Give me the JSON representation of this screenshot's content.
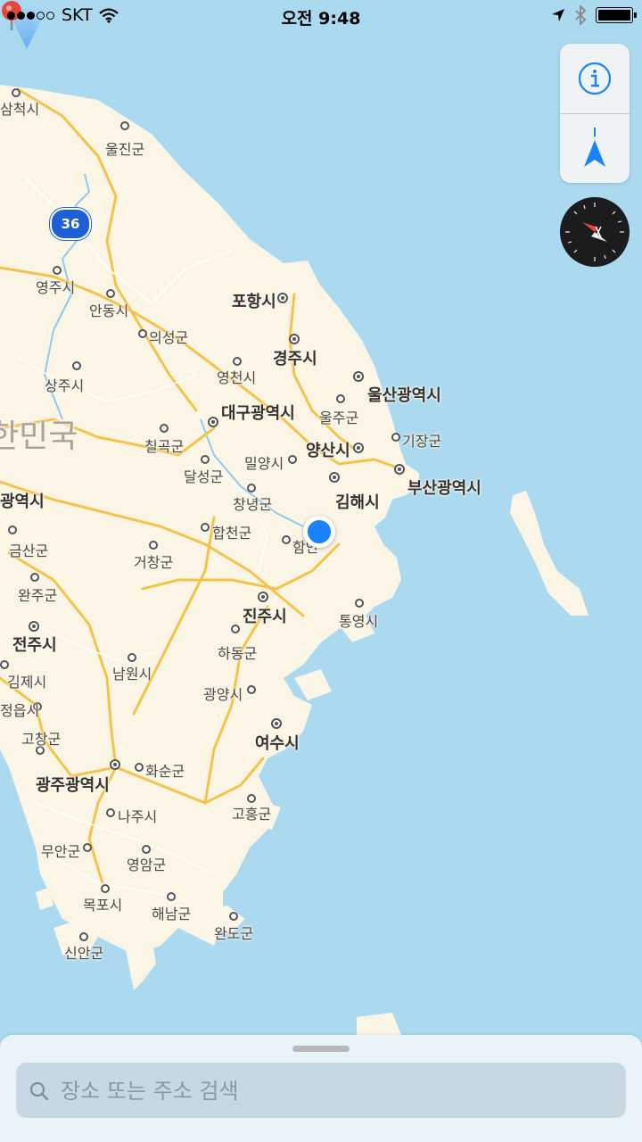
{
  "status_bar": {
    "carrier": "SKT",
    "time": "오전 9:48",
    "signal_bars_filled": 3,
    "signal_bars_total": 5
  },
  "map": {
    "route_shield": "36",
    "country_label": "한민국",
    "labels": [
      "삼척시",
      "울진군",
      "영주시",
      "안동시",
      "의성군",
      "포항시",
      "경주시",
      "영천시",
      "상주시",
      "대구광역시",
      "울산광역시",
      "울주군",
      "칠곡군",
      "기장군",
      "양산시",
      "달성군",
      "밀양시",
      "부산광역시",
      "김해시",
      "창녕군",
      "광역시",
      "합천군",
      "금산군",
      "거창군",
      "함안",
      "완주군",
      "진주시",
      "통영시",
      "전주시",
      "하동군",
      "남원시",
      "김제시",
      "광양시",
      "정읍시",
      "여수시",
      "고창군",
      "광주광역시",
      "화순군",
      "나주시",
      "고흥군",
      "무안군",
      "영암군",
      "목포시",
      "해남군",
      "완도군",
      "신안군"
    ]
  },
  "controls": {
    "info_icon": "info-icon",
    "tracking_icon": "location-arrow-icon",
    "compass_icon": "compass-icon"
  },
  "search": {
    "placeholder": "장소 또는 주소 검색"
  },
  "colors": {
    "water": "#aad9f0",
    "land": "#fbf5e6",
    "highway": "#f4c44a",
    "accent": "#1a82fb"
  }
}
